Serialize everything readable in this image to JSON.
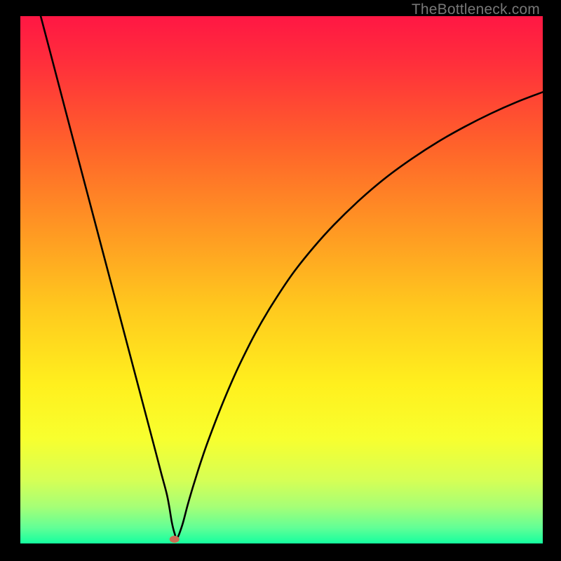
{
  "watermark": "TheBottleneck.com",
  "chart_data": {
    "type": "line",
    "title": "",
    "xlabel": "",
    "ylabel": "",
    "xlim": [
      0,
      100
    ],
    "ylim": [
      0,
      100
    ],
    "gradient_stops": [
      {
        "offset": 0.0,
        "color": "#ff1744"
      },
      {
        "offset": 0.09,
        "color": "#ff2f3b"
      },
      {
        "offset": 0.25,
        "color": "#ff642a"
      },
      {
        "offset": 0.4,
        "color": "#ff9623"
      },
      {
        "offset": 0.55,
        "color": "#ffc81e"
      },
      {
        "offset": 0.7,
        "color": "#fff01e"
      },
      {
        "offset": 0.8,
        "color": "#f8ff2e"
      },
      {
        "offset": 0.88,
        "color": "#d6ff55"
      },
      {
        "offset": 0.93,
        "color": "#a6ff76"
      },
      {
        "offset": 0.97,
        "color": "#62ff96"
      },
      {
        "offset": 1.0,
        "color": "#14ff9f"
      }
    ],
    "series": [
      {
        "name": "curve",
        "x": [
          3.9,
          6,
          10,
          14,
          18,
          22,
          24,
          26,
          27,
          28,
          28.5,
          29,
          29.5,
          30,
          31,
          32,
          33,
          34,
          35,
          36,
          38,
          40,
          42,
          45,
          48,
          52,
          56,
          60,
          65,
          70,
          75,
          80,
          85,
          90,
          95,
          100
        ],
        "y": [
          100,
          92.1,
          77.0,
          62.0,
          47.0,
          32.0,
          24.5,
          17.0,
          13.2,
          9.5,
          7.0,
          4.0,
          2.0,
          1.0,
          3.5,
          7.2,
          10.6,
          13.8,
          16.8,
          19.6,
          24.8,
          29.6,
          34.0,
          39.9,
          45.0,
          51.0,
          56.0,
          60.4,
          65.2,
          69.4,
          73.0,
          76.2,
          79.0,
          81.5,
          83.7,
          85.6
        ]
      }
    ],
    "marker": {
      "x": 29.5,
      "y": 0.8,
      "color": "#cc6b54"
    }
  }
}
